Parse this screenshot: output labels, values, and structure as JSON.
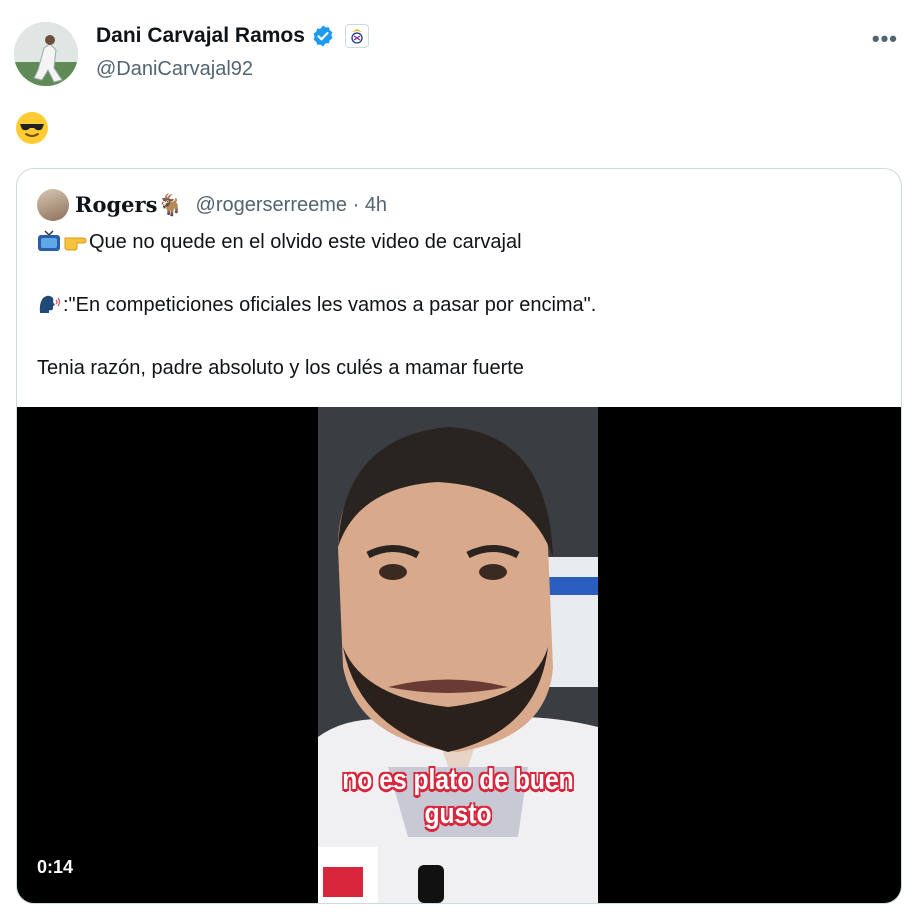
{
  "author": {
    "display_name": "Dani Carvajal Ramos",
    "handle": "@DaniCarvajal92",
    "verified_icon": "verified-badge-icon",
    "affiliate_icon": "real-madrid-crest-icon"
  },
  "more_icon": "more-options-icon",
  "tweet": {
    "emoji": "😎"
  },
  "quoted_tweet": {
    "display_name": "Rogers🐐",
    "handle": "@rogerserreeme",
    "separator": "·",
    "timestamp": "4h",
    "lines": [
      "Que no quede en el olvido este video de carvajal",
      ":\"En competiciones oficiales les vamos a pasar por encima\".",
      "Tenia razón, padre absoluto y los culés a mamar fuerte"
    ],
    "line_icons": [
      "tv-icon",
      "pointing-right-icon",
      "speaking-head-icon"
    ],
    "video": {
      "caption_line1": "no es plato de buen",
      "caption_line2": "gusto",
      "duration": "0:14"
    }
  },
  "colors": {
    "text": "#0f1419",
    "secondary": "#536471",
    "border": "#cfd9de",
    "verified": "#1d9bf0",
    "caption_outline": "#d8263c"
  }
}
